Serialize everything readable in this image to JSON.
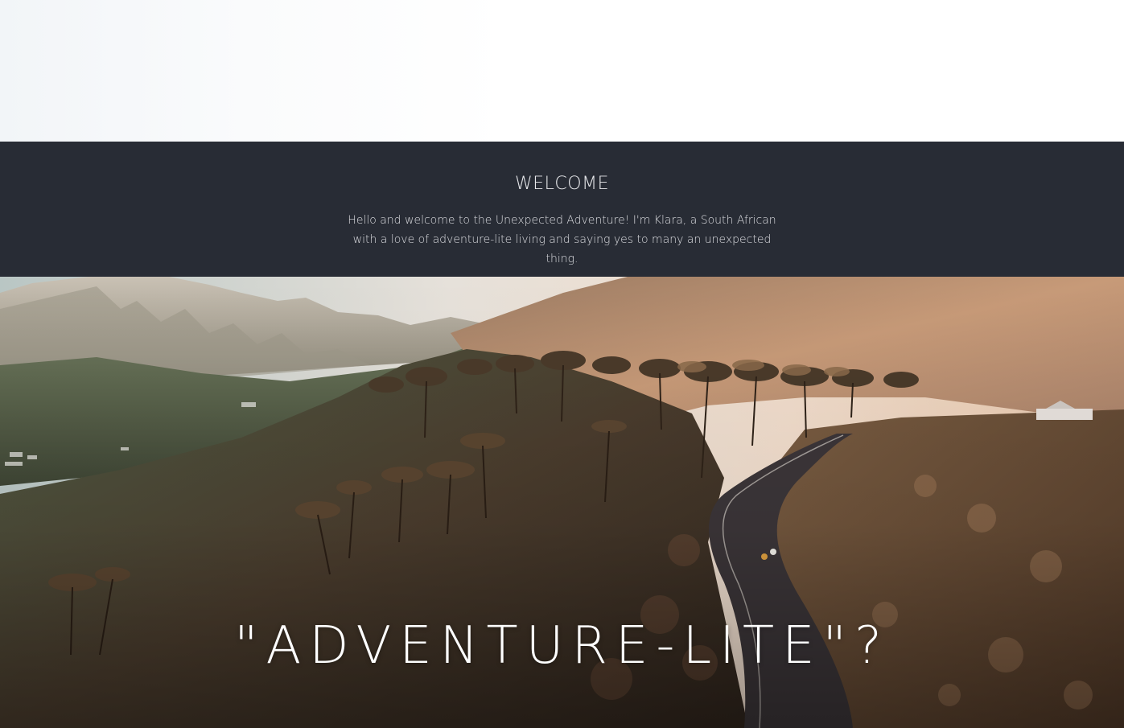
{
  "welcome": {
    "title": "WELCOME",
    "text": "Hello and welcome to the Unexpected Adventure! I'm Klara, a South African with a love of adventure-lite living and saying yes to many an unexpected thing."
  },
  "hero": {
    "caption": "\"ADVENTURE-LITE\"?"
  },
  "colors": {
    "welcome_bg": "#282c35",
    "welcome_text": "#e6e7ea",
    "caption_text": "#ffffff"
  }
}
